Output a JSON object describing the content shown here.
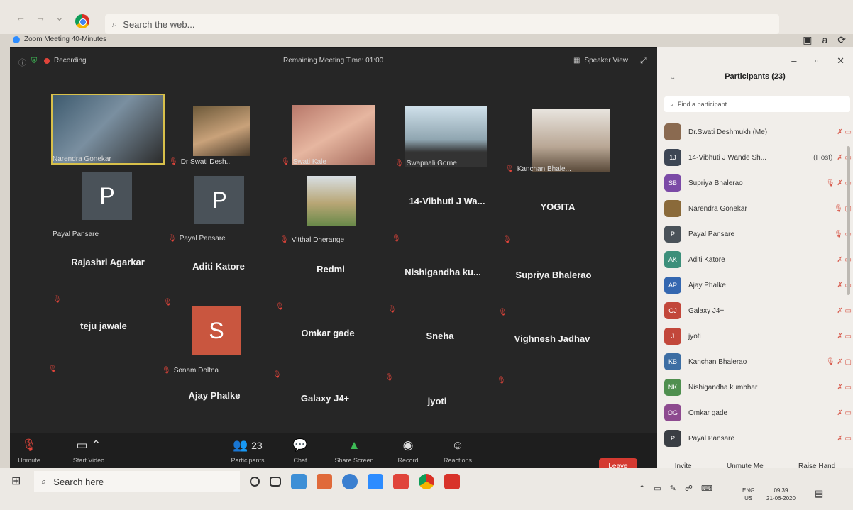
{
  "browser": {
    "search_placeholder": "Search the web..."
  },
  "zoom": {
    "window_title": "Zoom Meeting 40-Minutes",
    "recording_label": "Recording",
    "remaining_time": "Remaining Meeting Time: 01:00",
    "view_label": "Speaker View"
  },
  "tiles": [
    {
      "name": "Narendra Gonekar",
      "type": "video",
      "active": true
    },
    {
      "name": "Dr Swati Desh...",
      "type": "video"
    },
    {
      "name": "Swati Kale",
      "type": "video"
    },
    {
      "name": "Swapnali Gorne",
      "type": "video"
    },
    {
      "name": "Kanchan Bhale...",
      "type": "video"
    },
    {
      "name": "Payal Pansare",
      "type": "avatar",
      "letter": "P",
      "color": "#4a5259"
    },
    {
      "name": "Payal Pansare",
      "type": "avatar",
      "letter": "P",
      "color": "#4a5259"
    },
    {
      "name": "Vitthal Dherange",
      "type": "video"
    },
    {
      "name": "14-Vibhuti J Wa...",
      "type": "text"
    },
    {
      "name": "YOGITA",
      "type": "text"
    },
    {
      "name": "Rajashri Agarkar",
      "type": "text"
    },
    {
      "name": "Aditi Katore",
      "type": "text"
    },
    {
      "name": "Redmi",
      "type": "text"
    },
    {
      "name": "Nishigandha ku...",
      "type": "text"
    },
    {
      "name": "Supriya Bhalerao",
      "type": "text"
    },
    {
      "name": "teju jawale",
      "type": "text"
    },
    {
      "name": "Sonam Doltna",
      "type": "avatar",
      "letter": "S",
      "color": "#c9563f"
    },
    {
      "name": "Omkar gade",
      "type": "text"
    },
    {
      "name": "Sneha",
      "type": "text"
    },
    {
      "name": "Vighnesh Jadhav",
      "type": "text"
    },
    {
      "name": "Ajay Phalke",
      "type": "text"
    },
    {
      "name": "Galaxy J4+",
      "type": "text"
    },
    {
      "name": "jyoti",
      "type": "text"
    }
  ],
  "controls": {
    "unmute": "Unmute",
    "start_video": "Start Video",
    "participants": "Participants",
    "participant_count": "23",
    "chat": "Chat",
    "share_screen": "Share Screen",
    "record": "Record",
    "reactions": "Reactions",
    "leave": "Leave"
  },
  "panel": {
    "title": "Participants (23)",
    "find_placeholder": "Find a participant",
    "participants": [
      {
        "name": "Dr.Swati Deshmukh (Me)",
        "initials": "",
        "color": "#8a6a50",
        "status": "mic-off video-off"
      },
      {
        "name": "14-Vibhuti J Wande Sh...",
        "initials": "1J",
        "color": "#3d4654",
        "status": "mic-off video-off",
        "extra": "(Host)"
      },
      {
        "name": "Supriya Bhalerao",
        "initials": "SB",
        "color": "#7b4aa6",
        "status": "mic-on mic-off video-off"
      },
      {
        "name": "Narendra Gonekar",
        "initials": "",
        "color": "#8a6a3a",
        "status": "mic-on video-on"
      },
      {
        "name": "Payal Pansare",
        "initials": "P",
        "color": "#4a5259",
        "status": "mic-on video-off"
      },
      {
        "name": "Aditi Katore",
        "initials": "AK",
        "color": "#3c8f7a",
        "status": "mic-off video-off"
      },
      {
        "name": "Ajay Phalke",
        "initials": "AP",
        "color": "#3467b0",
        "status": "mic-off video-off"
      },
      {
        "name": "Galaxy J4+",
        "initials": "GJ",
        "color": "#c2473a",
        "status": "mic-off video-off"
      },
      {
        "name": "jyoti",
        "initials": "J",
        "color": "#c2473a",
        "status": "mic-off video-off"
      },
      {
        "name": "Kanchan Bhalerao",
        "initials": "KB",
        "color": "#3d6ea3",
        "status": "mic-on mic-off video-on"
      },
      {
        "name": "Nishigandha kumbhar",
        "initials": "NK",
        "color": "#4f8f4f",
        "status": "mic-off video-off"
      },
      {
        "name": "Omkar gade",
        "initials": "OG",
        "color": "#8d4a8f",
        "status": "mic-off video-off"
      },
      {
        "name": "Payal Pansare",
        "initials": "P",
        "color": "#3a3e44",
        "status": "mic-off video-off"
      }
    ],
    "invite": "Invite",
    "unmute_me": "Unmute Me",
    "raise_hand": "Raise Hand"
  },
  "taskbar": {
    "search_placeholder": "Search here",
    "lang_top": "ENG",
    "lang_bottom": "US",
    "time": "09:39",
    "date": "21-06-2020"
  }
}
